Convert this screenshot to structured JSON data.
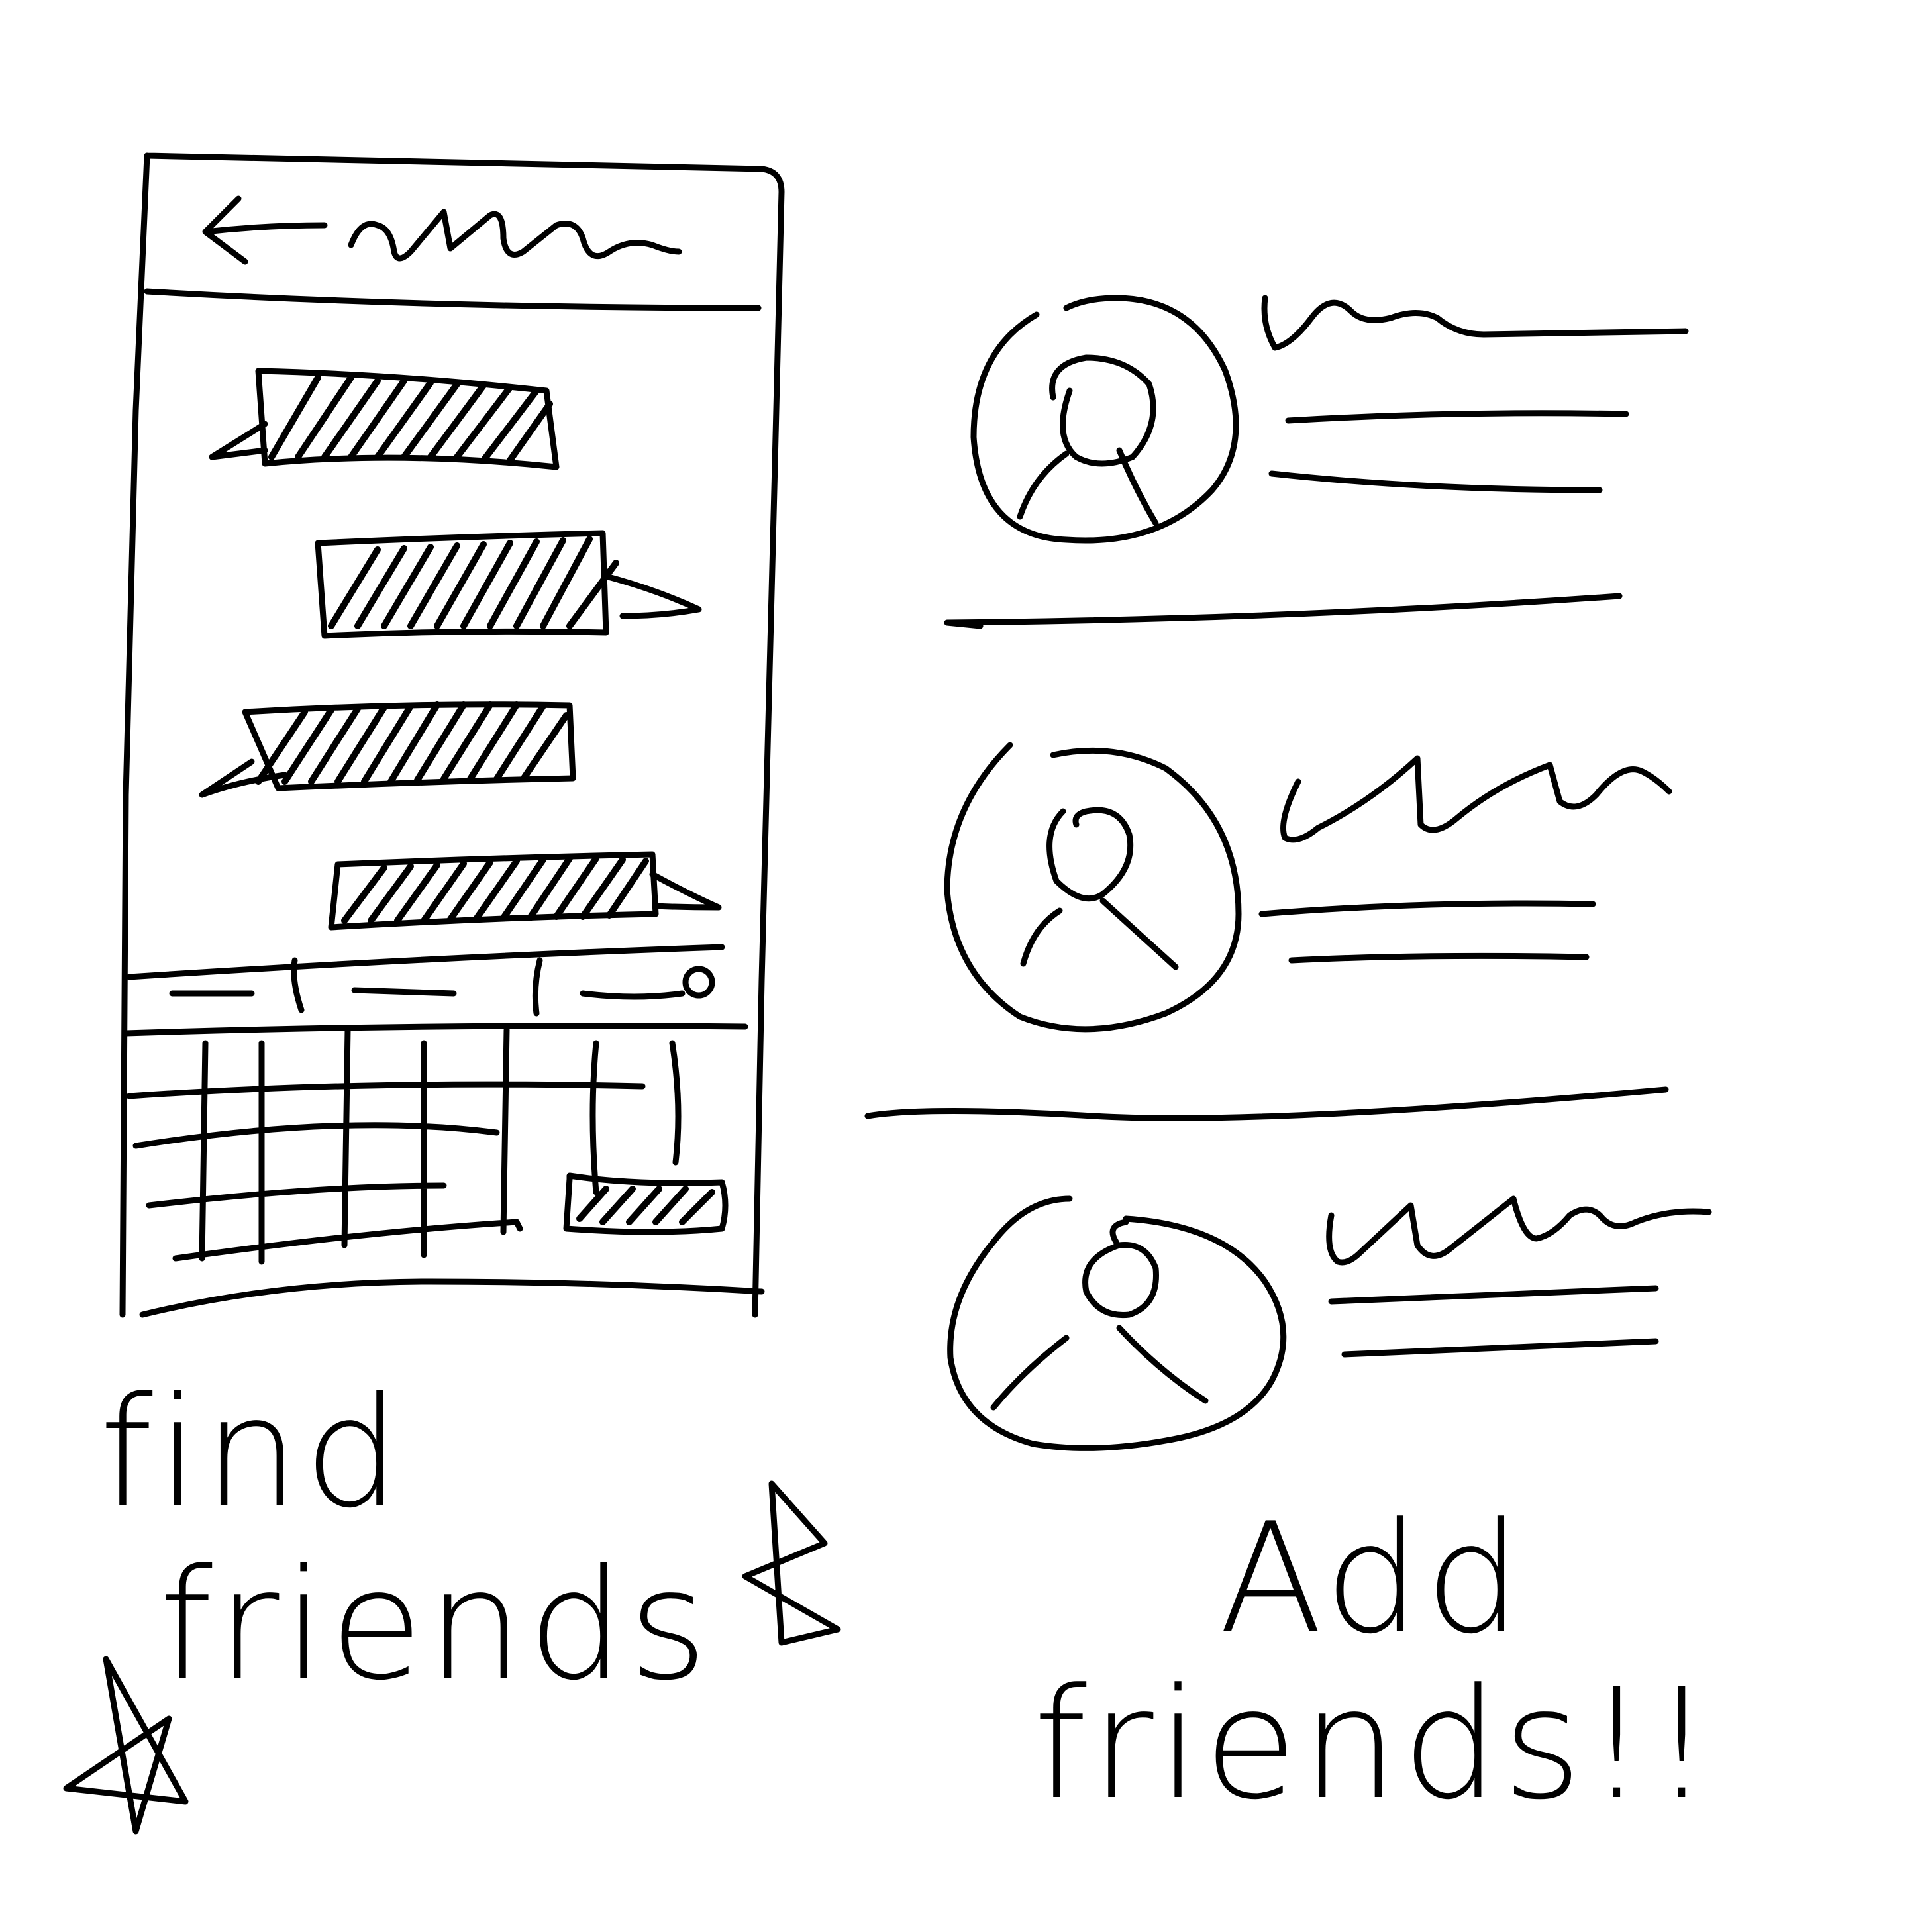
{
  "captions": {
    "find_friends": {
      "line1": "find",
      "line2": "friends"
    },
    "add_friends": {
      "line1": "Add",
      "line2": "friends!!"
    }
  },
  "icons": {
    "back": "back-arrow-icon",
    "profile": "user-avatar-icon",
    "star": "star-icon"
  },
  "colors": {
    "ink": "#000000",
    "paper": "#ffffff"
  }
}
